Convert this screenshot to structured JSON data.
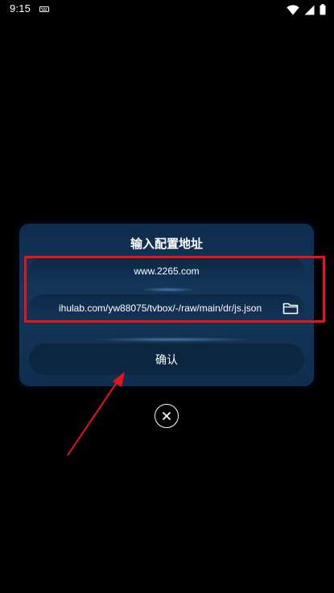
{
  "status_bar": {
    "time": "9:15",
    "icons": [
      "keyboard-icon",
      "wifi-icon",
      "signal-icon",
      "battery-icon"
    ]
  },
  "dialog": {
    "title": "输入配置地址",
    "url_field_value": "www.2265.com",
    "path_field_value": "ihulab.com/yw88075/tvbox/-/raw/main/dr/js.json",
    "confirm_label": "确认"
  },
  "icons": {
    "folder": "folder-icon",
    "close": "close-icon"
  },
  "colors": {
    "dialog_bg": "#123659",
    "annotation_red": "#e8121c",
    "background": "#000000"
  }
}
